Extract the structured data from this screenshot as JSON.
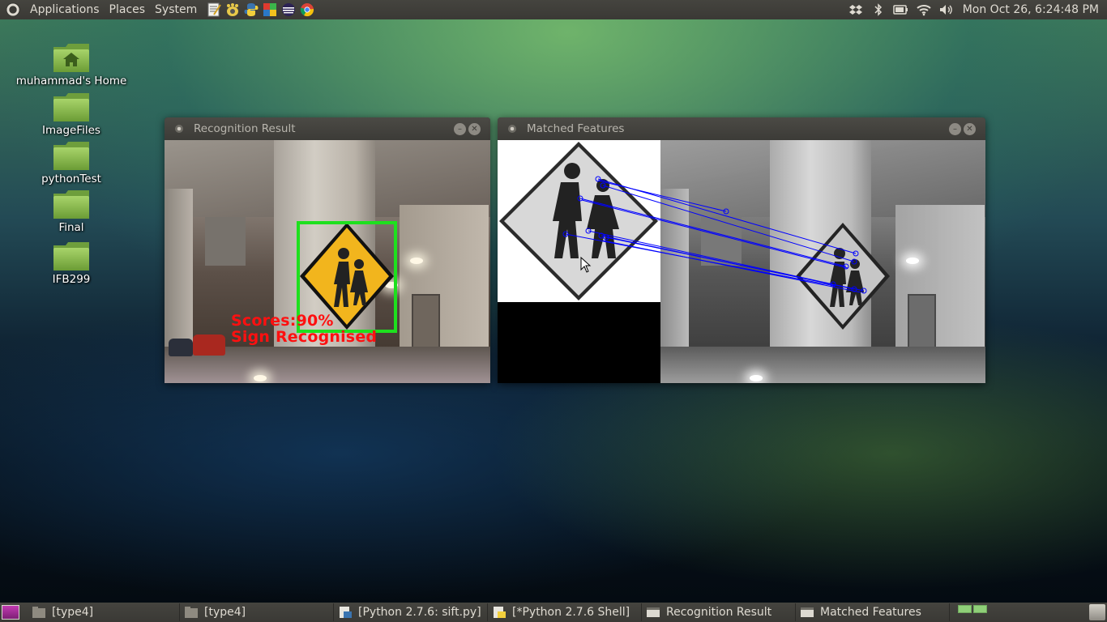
{
  "top_panel": {
    "menus": [
      "Applications",
      "Places",
      "System"
    ],
    "launchers": [
      "text-editor-icon",
      "gnome-foot-icon",
      "python-icon",
      "office-suite-icon",
      "eclipse-icon",
      "chrome-icon"
    ],
    "tray": [
      "dropbox-icon",
      "bluetooth-icon",
      "battery-icon",
      "wifi-icon",
      "volume-icon"
    ],
    "clock": "Mon Oct 26,  6:24:48 PM"
  },
  "desktop_icons": [
    {
      "label": "muhammad's Home",
      "icon": "home-folder-icon"
    },
    {
      "label": "ImageFiles",
      "icon": "folder-icon"
    },
    {
      "label": "pythonTest",
      "icon": "folder-icon"
    },
    {
      "label": "Final",
      "icon": "folder-icon"
    },
    {
      "label": "IFB299",
      "icon": "folder-icon"
    }
  ],
  "windows": {
    "recognition": {
      "title": "Recognition Result",
      "overlay_line1": "Scores:90%",
      "overlay_line2": "Sign  Recognised",
      "box_color": "#1ee01e",
      "text_color": "#ff1010"
    },
    "matched": {
      "title": "Matched Features",
      "match_line_color": "#0000ff"
    }
  },
  "taskbar": {
    "tasks": [
      {
        "label": "[type4]",
        "icon": "folder-icon"
      },
      {
        "label": "[type4]",
        "icon": "folder-icon"
      },
      {
        "label": "[Python 2.7.6: sift.py]",
        "icon": "python-editor-icon"
      },
      {
        "label": "[*Python 2.7.6 Shell]",
        "icon": "python-shell-icon"
      },
      {
        "label": "Recognition Result",
        "icon": "window-icon"
      },
      {
        "label": "Matched Features",
        "icon": "window-icon"
      }
    ]
  }
}
